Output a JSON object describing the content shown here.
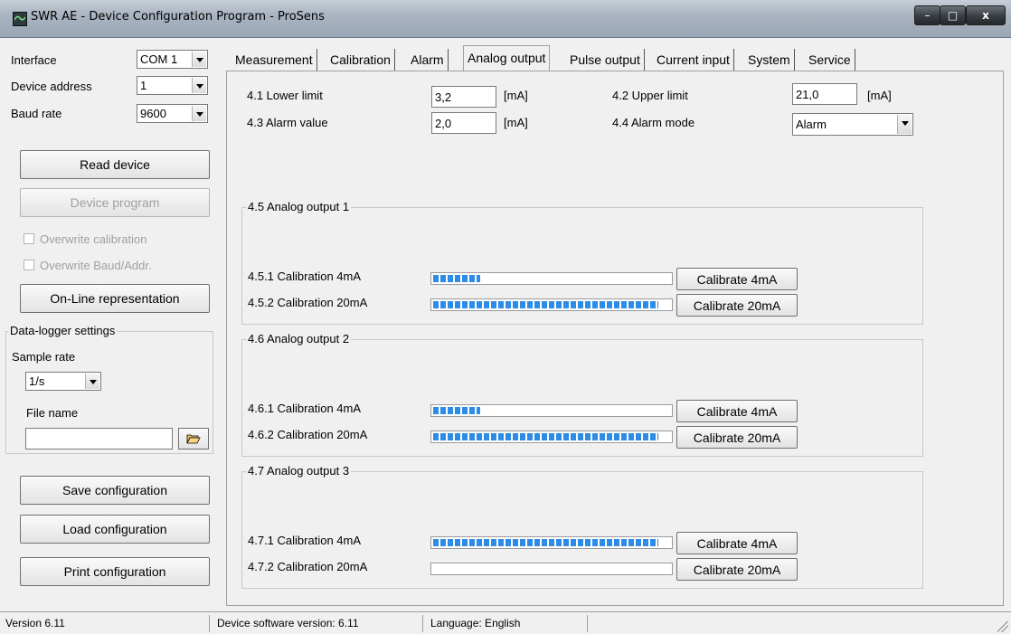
{
  "window": {
    "title": "SWR AE - Device Configuration Program - ProSens",
    "minimize": "–",
    "maximize": "□",
    "close": "x"
  },
  "sidebar": {
    "interface_label": "Interface",
    "interface_value": "COM 1",
    "device_address_label": "Device address",
    "device_address_value": "1",
    "baud_rate_label": "Baud rate",
    "baud_rate_value": "9600",
    "read_device": "Read device",
    "device_program": "Device program",
    "overwrite_calibration": "Overwrite calibration",
    "overwrite_baud_addr": "Overwrite Baud/Addr.",
    "online_representation": "On-Line representation",
    "datalogger": {
      "title": "Data-logger settings",
      "sample_rate_label": "Sample rate",
      "sample_rate_value": "1/s",
      "file_name_label": "File name",
      "file_name_value": ""
    },
    "save_configuration": "Save configuration",
    "load_configuration": "Load configuration",
    "print_configuration": "Print configuration"
  },
  "tabs": [
    {
      "label": "Measurement",
      "active": false
    },
    {
      "label": "Calibration",
      "active": false
    },
    {
      "label": "Alarm",
      "active": false
    },
    {
      "label": "Analog output",
      "active": true
    },
    {
      "label": "Pulse output",
      "active": false
    },
    {
      "label": "Current input",
      "active": false
    },
    {
      "label": "System",
      "active": false
    },
    {
      "label": "Service",
      "active": false
    }
  ],
  "analog": {
    "lower_limit_label": "4.1 Lower limit",
    "lower_limit_value": "3,2",
    "upper_limit_label": "4.2 Upper limit",
    "upper_limit_value": "21,0",
    "alarm_value_label": "4.3 Alarm value",
    "alarm_value_value": "2,0",
    "alarm_mode_label": "4.4 Alarm mode",
    "alarm_mode_value": "Alarm",
    "unit": "[mA]"
  },
  "outputs": [
    {
      "title": "4.5 Analog output 1",
      "cal4_label": "4.5.1 Calibration 4mA",
      "cal4_progress": 0.2,
      "cal4_button": "Calibrate 4mA",
      "cal20_label": "4.5.2 Calibration 20mA",
      "cal20_progress": 0.95,
      "cal20_button": "Calibrate 20mA"
    },
    {
      "title": "4.6 Analog output 2",
      "cal4_label": "4.6.1 Calibration 4mA",
      "cal4_progress": 0.2,
      "cal4_button": "Calibrate 4mA",
      "cal20_label": "4.6.2 Calibration 20mA",
      "cal20_progress": 0.95,
      "cal20_button": "Calibrate 20mA"
    },
    {
      "title": "4.7 Analog output 3",
      "cal4_label": "4.7.1 Calibration 4mA",
      "cal4_progress": 0.95,
      "cal4_button": "Calibrate 4mA",
      "cal20_label": "4.7.2 Calibration 20mA",
      "cal20_progress": 0,
      "cal20_button": "Calibrate 20mA"
    }
  ],
  "status": {
    "version": "Version 6.11",
    "device_software": "Device software version: 6.11",
    "language": "Language: English"
  }
}
